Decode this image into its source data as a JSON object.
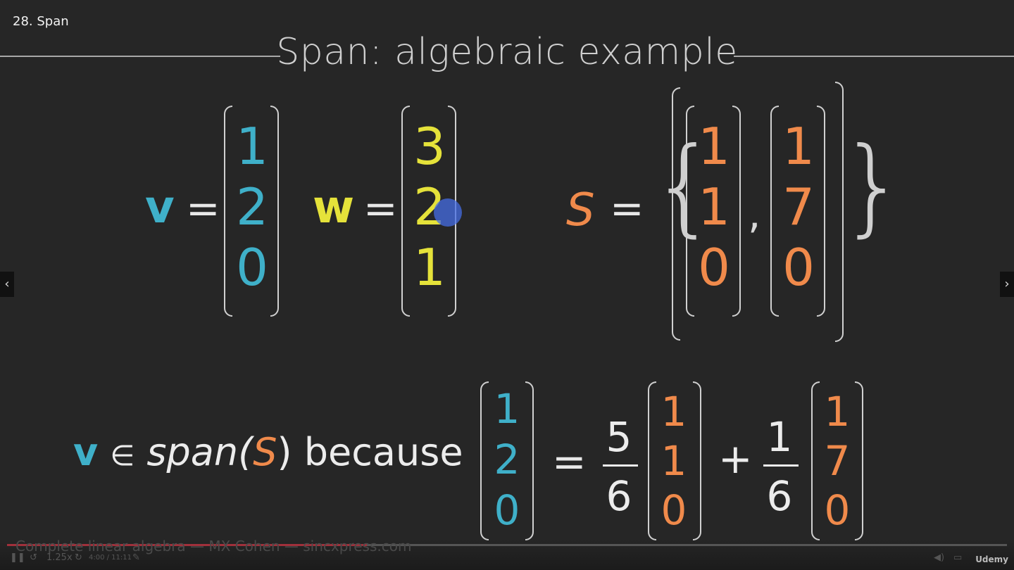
{
  "lecture": {
    "title": "28. Span"
  },
  "slide": {
    "title": "Span: algebraic example"
  },
  "top": {
    "v_label": "v",
    "w_label": "w",
    "s_label": "S",
    "equals": "=",
    "v": [
      "1",
      "2",
      "0"
    ],
    "w": [
      "3",
      "2",
      "1"
    ],
    "s1": [
      "1",
      "1",
      "0"
    ],
    "s2": [
      "1",
      "7",
      "0"
    ],
    "comma": ",",
    "brace_l": "{",
    "brace_r": "}"
  },
  "bottom": {
    "v_label": "v",
    "in": "∈",
    "span": "span(",
    "s": "S",
    "close": ")",
    "because": "because",
    "vec": [
      "1",
      "2",
      "0"
    ],
    "equals": "=",
    "coef1_num": "5",
    "coef1_den": "6",
    "s1": [
      "1",
      "1",
      "0"
    ],
    "plus": "+",
    "coef2_num": "1",
    "coef2_den": "6",
    "s2": [
      "1",
      "7",
      "0"
    ]
  },
  "player": {
    "watermark": "Complete linear algebra — MX Cohen — sincxpress.com",
    "time": "4:00 / 11:11",
    "speed": "1.25x",
    "progress": 0.36,
    "brand": "Udemy"
  },
  "colors": {
    "blue": "#3fb0c9",
    "yellow": "#e5e23a",
    "orange": "#f08a4b",
    "bg": "#262626"
  }
}
